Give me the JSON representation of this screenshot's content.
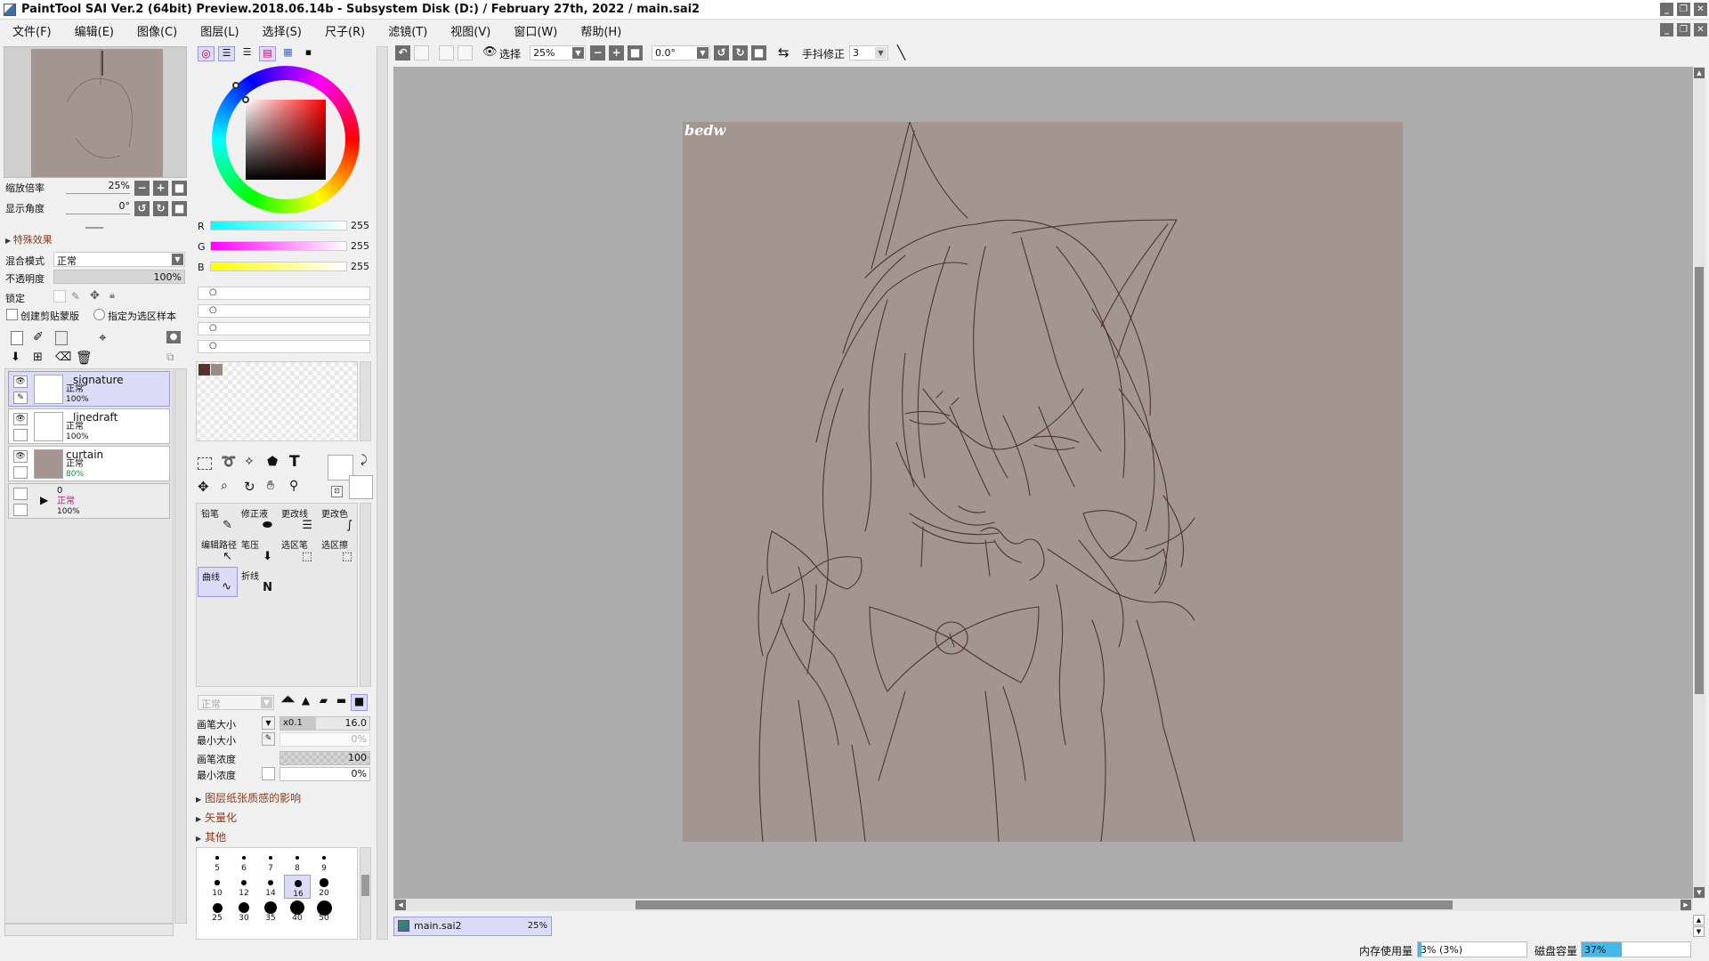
{
  "titlebar": {
    "title": "PaintTool SAI Ver.2 (64bit) Preview.2018.06.14b - Subsystem Disk (D:) / February 27th, 2022 / main.sai2"
  },
  "menu": [
    "文件(F)",
    "编辑(E)",
    "图像(C)",
    "图层(L)",
    "选择(S)",
    "尺子(R)",
    "滤镜(T)",
    "视图(V)",
    "窗口(W)",
    "帮助(H)"
  ],
  "navigator": {
    "zoom_label": "缩放倍率",
    "zoom_value": "25%",
    "angle_label": "显示角度",
    "angle_value": "0°"
  },
  "layer_props": {
    "effects_label": "特殊效果",
    "blend_label": "混合模式",
    "blend_value": "正常",
    "opacity_label": "不透明度",
    "opacity_value": "100%",
    "lock_label": "锁定",
    "clip_label": "创建剪贴蒙版",
    "sample_label": "指定为选区样本"
  },
  "layers": [
    {
      "name": "signature",
      "mode": "正常",
      "opacity": "100%"
    },
    {
      "name": "linedraft",
      "mode": "正常",
      "opacity": "100%"
    },
    {
      "name": "curtain",
      "mode": "正常",
      "opacity": "80%"
    },
    {
      "name": "0",
      "mode": "正常",
      "opacity": "100%"
    }
  ],
  "color": {
    "r_label": "R",
    "r_value": "255",
    "g_label": "G",
    "g_value": "255",
    "b_label": "B",
    "b_value": "255",
    "swatches": [
      "#5a3228",
      "#9a8a86"
    ]
  },
  "tools": [
    {
      "name": "铅笔",
      "icon": "✎"
    },
    {
      "name": "修正液",
      "icon": "⬬"
    },
    {
      "name": "更改线",
      "icon": "☰"
    },
    {
      "name": "更改色",
      "icon": "∫"
    },
    {
      "name": "编辑路径",
      "icon": "↖"
    },
    {
      "name": "笔压",
      "icon": "⬇"
    },
    {
      "name": "选区笔",
      "icon": "⬚"
    },
    {
      "name": "选区擦",
      "icon": "⬚"
    },
    {
      "name": "曲线",
      "icon": "∿"
    },
    {
      "name": "折线",
      "icon": "N"
    }
  ],
  "brush": {
    "mode_value": "正常",
    "size_label": "画笔大小",
    "size_mult": "x0.1",
    "size_value": "16.0",
    "min_size_label": "最小大小",
    "min_size_value": "0%",
    "density_label": "画笔浓度",
    "density_value": "100",
    "min_density_label": "最小浓度",
    "min_density_value": "0%",
    "sec_paper": "图层纸张质感的影响",
    "sec_vector": "矢量化",
    "sec_other": "其他",
    "sizes": [
      "5",
      "6",
      "7",
      "8",
      "9",
      "10",
      "12",
      "14",
      "16",
      "20",
      "25",
      "30",
      "35",
      "40",
      "50"
    ]
  },
  "toolbar": {
    "select_label": "选择",
    "zoom_value": "25%",
    "angle_value": "0.0°",
    "stab_label": "手抖修正",
    "stab_value": "3"
  },
  "canvas": {
    "signature_text": "bedw",
    "bg_color": "#a39691",
    "workspace_color": "#acacac"
  },
  "tabs": [
    {
      "name": "main.sai2",
      "zoom": "25%"
    }
  ],
  "status": {
    "mem_label": "内存使用量",
    "mem_value": "3% (3%)",
    "mem_fraction": 0.03,
    "disk_label": "磁盘容量",
    "disk_value": "37%",
    "disk_fraction": 0.37
  }
}
